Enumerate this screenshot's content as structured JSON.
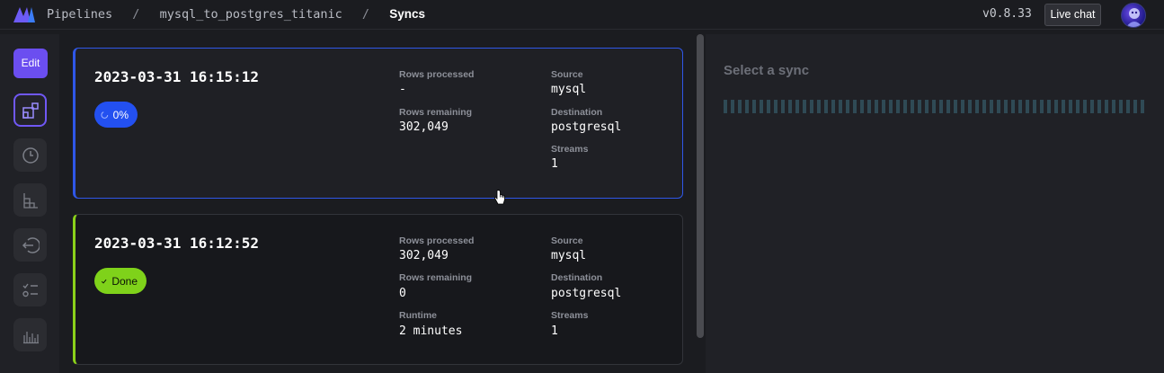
{
  "topbar": {
    "breadcrumbs": [
      "Pipelines",
      "mysql_to_postgres_titanic",
      "Syncs"
    ],
    "version": "v0.8.33",
    "live_chat_label": "Live chat"
  },
  "rail": {
    "edit_label": "Edit",
    "items": [
      "dashboard-icon",
      "clock-icon",
      "blocks-icon",
      "logout-icon",
      "checklist-icon",
      "bar-chart-icon"
    ]
  },
  "syncs": [
    {
      "timestamp": "2023-03-31 16:15:12",
      "status_text": "0%",
      "status": "running",
      "rows_processed_label": "Rows processed",
      "rows_processed": "-",
      "rows_remaining_label": "Rows remaining",
      "rows_remaining": "302,049",
      "source_label": "Source",
      "source": "mysql",
      "destination_label": "Destination",
      "destination": "postgresql",
      "streams_label": "Streams",
      "streams": "1"
    },
    {
      "timestamp": "2023-03-31 16:12:52",
      "status_text": "Done",
      "status": "done",
      "rows_processed_label": "Rows processed",
      "rows_processed": "302,049",
      "rows_remaining_label": "Rows remaining",
      "rows_remaining": "0",
      "runtime_label": "Runtime",
      "runtime": "2 minutes",
      "source_label": "Source",
      "source": "mysql",
      "destination_label": "Destination",
      "destination": "postgresql",
      "streams_label": "Streams",
      "streams": "1"
    }
  ],
  "detail": {
    "title": "Select a sync"
  },
  "colors": {
    "accent": "#6b4ef0",
    "running": "#2350f0",
    "done": "#7fd21a"
  }
}
